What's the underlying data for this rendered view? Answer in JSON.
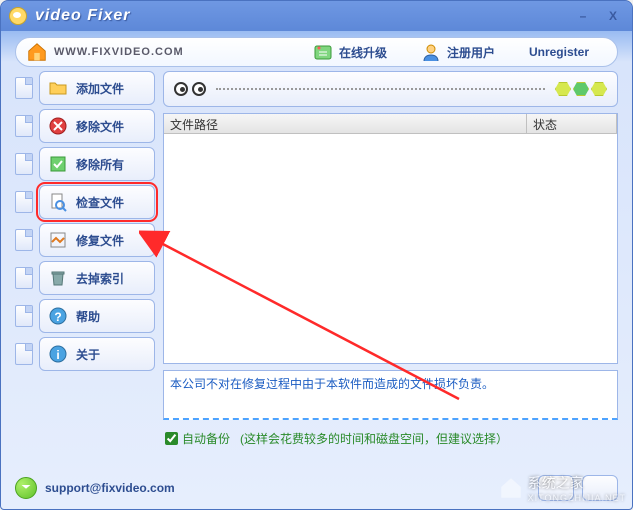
{
  "title": "video Fixer",
  "url_text": "WWW.FIXVIDEO.COM",
  "top": {
    "upgrade": "在线升级",
    "register": "注册用户",
    "unregister": "Unregister"
  },
  "sidebar": {
    "items": [
      {
        "label": "添加文件",
        "icon": "folder-open-icon"
      },
      {
        "label": "移除文件",
        "icon": "remove-icon"
      },
      {
        "label": "移除所有",
        "icon": "remove-all-icon"
      },
      {
        "label": "检查文件",
        "icon": "search-doc-icon"
      },
      {
        "label": "修复文件",
        "icon": "repair-icon"
      },
      {
        "label": "去掉索引",
        "icon": "trash-icon"
      },
      {
        "label": "帮助",
        "icon": "help-icon"
      },
      {
        "label": "关于",
        "icon": "info-icon"
      }
    ],
    "highlight_index": 3
  },
  "list": {
    "col_path": "文件路径",
    "col_status": "状态"
  },
  "message": "本公司不对在修复过程中由于本软件而造成的文件损坏负责。",
  "auto_backup": {
    "label": "自动备份",
    "checked": true,
    "hint": "(这样会花费较多的时间和磁盘空间，但建议选择）"
  },
  "support_email": "support@fixvideo.com",
  "watermark": {
    "main": "系统之家",
    "sub": "XITONGZHIJIA.NET"
  }
}
